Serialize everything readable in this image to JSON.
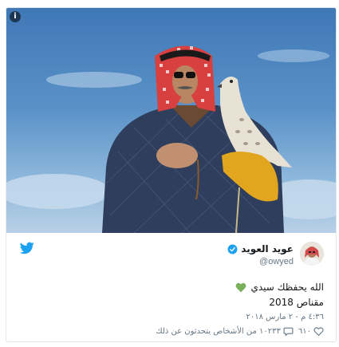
{
  "photo": {
    "description_icon": "info-icon",
    "icon_glyph": "i"
  },
  "user": {
    "display_name": "عويد العويد",
    "handle": "@owyed",
    "verified_icon": "verified-badge-icon",
    "avatar_icon": "avatar"
  },
  "tweet": {
    "line1": "الله يحفظك سيدي",
    "line1_emoji_icon": "green-heart-icon",
    "line2": "مقناص 2018",
    "timestamp": "٤:٣٦ م - ٢ مارس ٢٠١٨"
  },
  "actions": {
    "likes_icon": "heart-outline-icon",
    "likes_count": "٦١٠",
    "replies_icon": "speech-bubble-icon",
    "replies_text": "١٠٢٣٣ من الأشخاص يتحدثون عن ذلك"
  },
  "brand": {
    "twitter_icon": "twitter-bird-icon",
    "twitter_color": "#1da1f2",
    "verified_color": "#1da1f2",
    "heart_emoji_color": "#78b159"
  }
}
